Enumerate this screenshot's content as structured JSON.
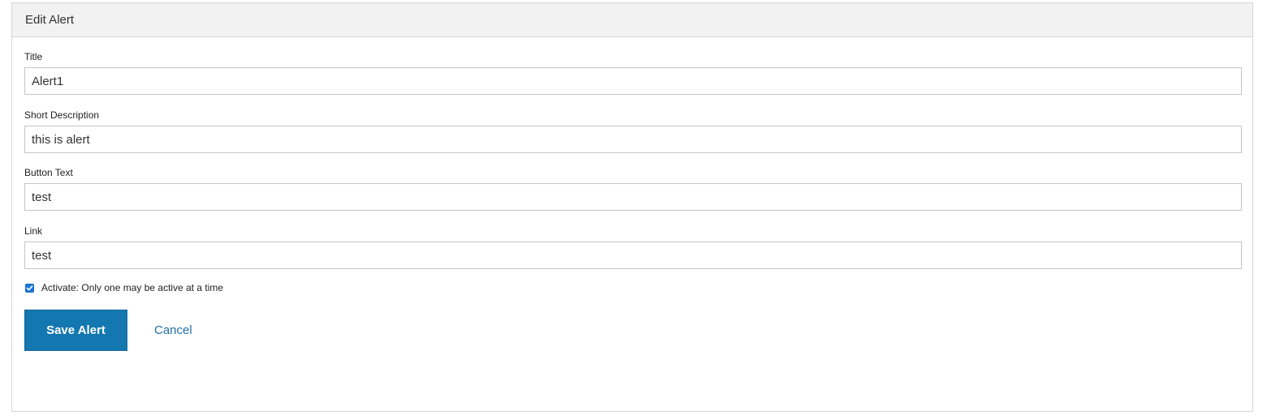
{
  "panel": {
    "title": "Edit Alert"
  },
  "form": {
    "title": {
      "label": "Title",
      "value": "Alert1"
    },
    "short_description": {
      "label": "Short Description",
      "value": "this is alert"
    },
    "button_text": {
      "label": "Button Text",
      "value": "test"
    },
    "link": {
      "label": "Link",
      "value": "test"
    },
    "activate": {
      "label": "Activate: Only one may be active at a time",
      "checked": true
    }
  },
  "actions": {
    "save_label": "Save Alert",
    "cancel_label": "Cancel"
  },
  "colors": {
    "primary_button": "#1478b0",
    "link": "#1f6fa5",
    "checkbox": "#1e78d7",
    "header_bg": "#f2f2f2"
  },
  "icons": {
    "checkbox_check": "check-icon"
  }
}
